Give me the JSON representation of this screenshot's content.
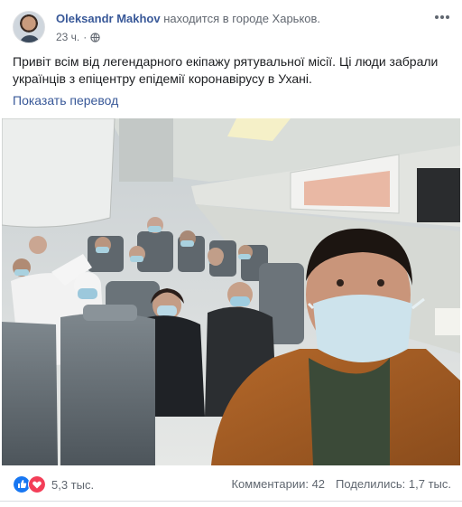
{
  "post": {
    "author": "Oleksandr Makhov",
    "location_text": "находится в городе Харьков.",
    "time": "23 ч.",
    "separator": "·",
    "text": "Привіт всім від легендарного екіпажу рятувальної місії. Ці люди забрали українців з епіцентру епідемії коронавірусу в Ухані.",
    "translate_link": "Показать перевод"
  },
  "reactions": {
    "icons": [
      "like-icon",
      "love-icon"
    ],
    "count": "5,3 тыс."
  },
  "stats": {
    "comments": "Комментарии: 42",
    "shares": "Поделились: 1,7 тыс."
  },
  "colors": {
    "link": "#385898",
    "secondary_text": "#616770",
    "like": "#1877f2",
    "love": "#f33e58"
  }
}
